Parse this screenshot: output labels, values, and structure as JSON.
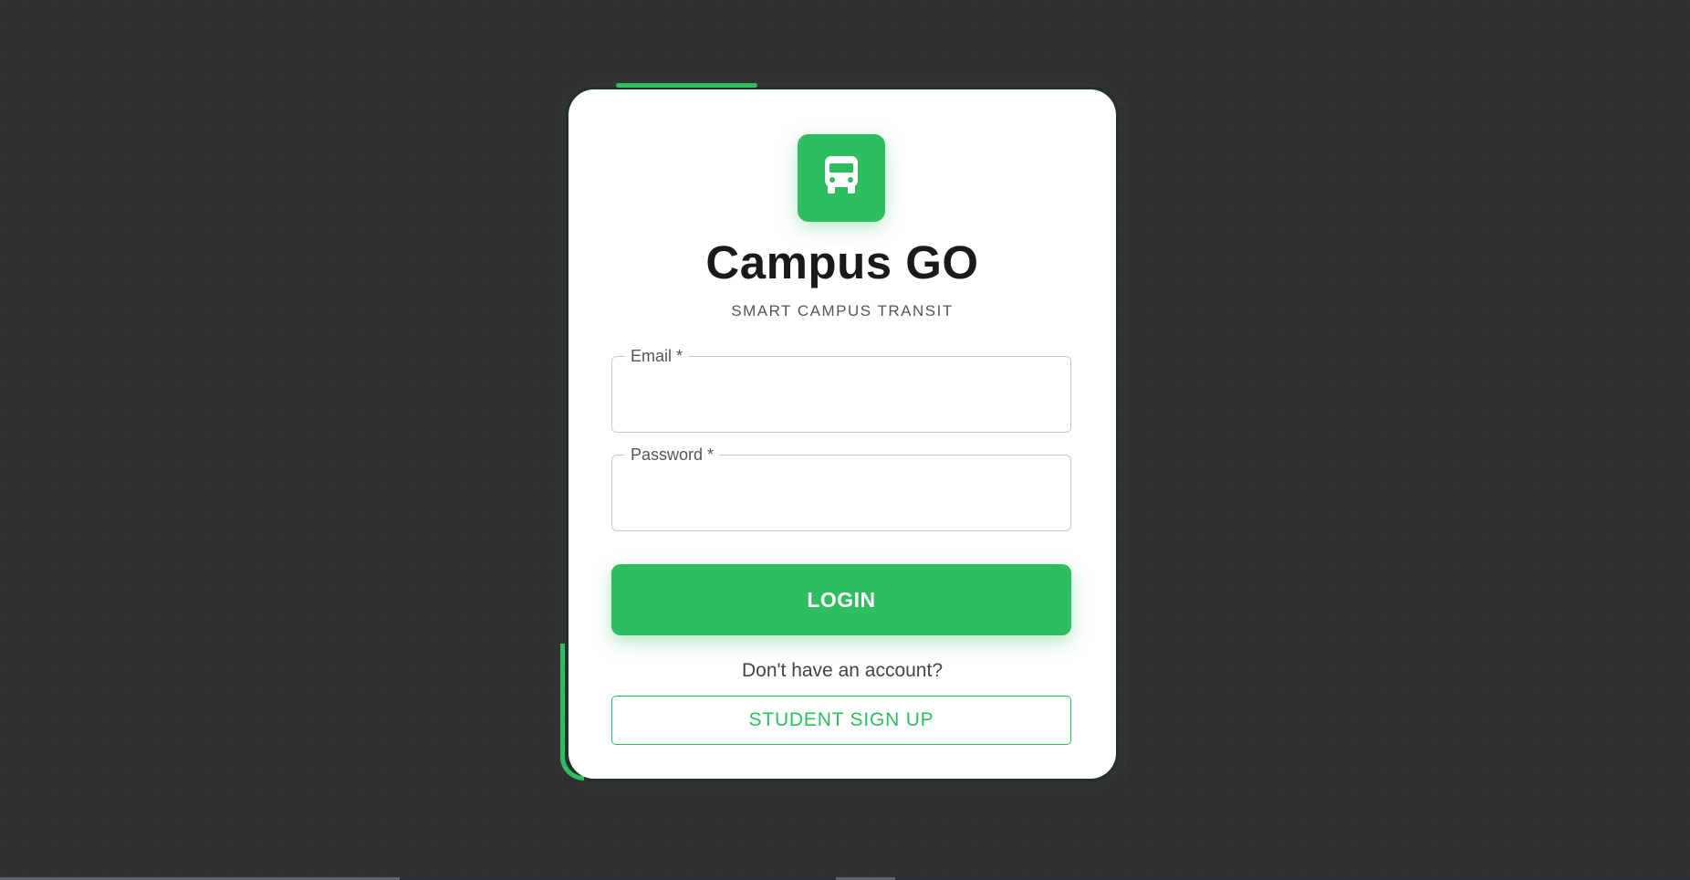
{
  "app": {
    "title": "Campus GO",
    "subtitle": "SMART CAMPUS TRANSIT",
    "logo_icon": "bus-icon"
  },
  "form": {
    "email": {
      "label": "Email *",
      "value": "",
      "placeholder": ""
    },
    "password": {
      "label": "Password *",
      "value": "",
      "placeholder": ""
    },
    "login_label": "LOGIN",
    "signup_prompt": "Don't have an account?",
    "signup_label": "STUDENT SIGN UP"
  },
  "colors": {
    "accent": "#2ebe60",
    "background": "#303030",
    "card": "#ffffff",
    "title_text": "#1a1a1a"
  }
}
